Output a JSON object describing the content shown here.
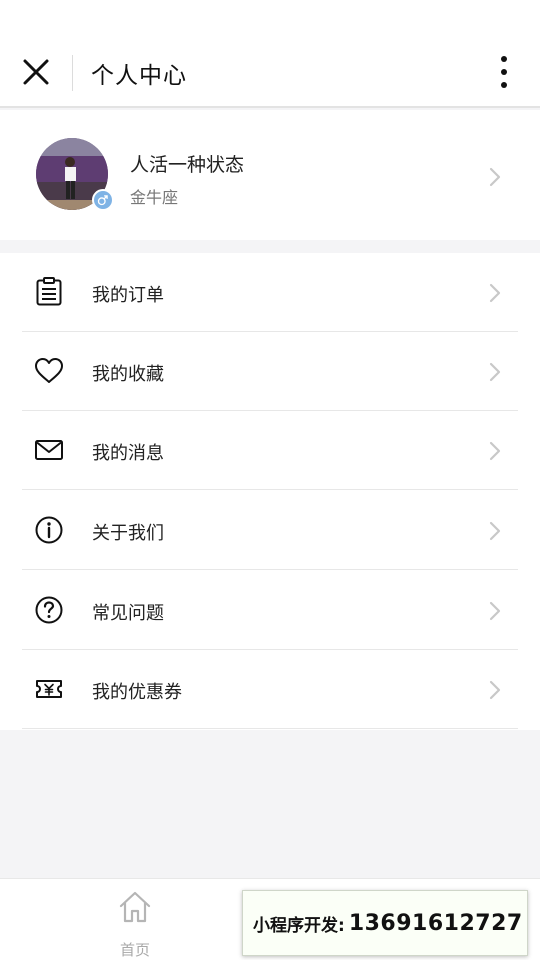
{
  "navbar": {
    "title": "个人中心",
    "close_icon": "close-icon",
    "more_icon": "more-vertical-icon"
  },
  "profile": {
    "name": "人活一种状态",
    "subtitle": "金牛座",
    "gender_icon": "male-symbol-icon",
    "badge_color": "#7fb3e5"
  },
  "menu": {
    "items": [
      {
        "label": "我的订单",
        "icon": "clipboard-icon"
      },
      {
        "label": "我的收藏",
        "icon": "heart-icon"
      },
      {
        "label": "我的消息",
        "icon": "envelope-icon"
      },
      {
        "label": "关于我们",
        "icon": "info-icon"
      },
      {
        "label": "常见问题",
        "icon": "question-icon"
      },
      {
        "label": "我的优惠券",
        "icon": "coupon-icon"
      }
    ]
  },
  "tabbar": {
    "home_label": "首页",
    "home_icon": "home-icon"
  },
  "promo": {
    "label": "小程序开发:",
    "phone": "13691612727"
  }
}
